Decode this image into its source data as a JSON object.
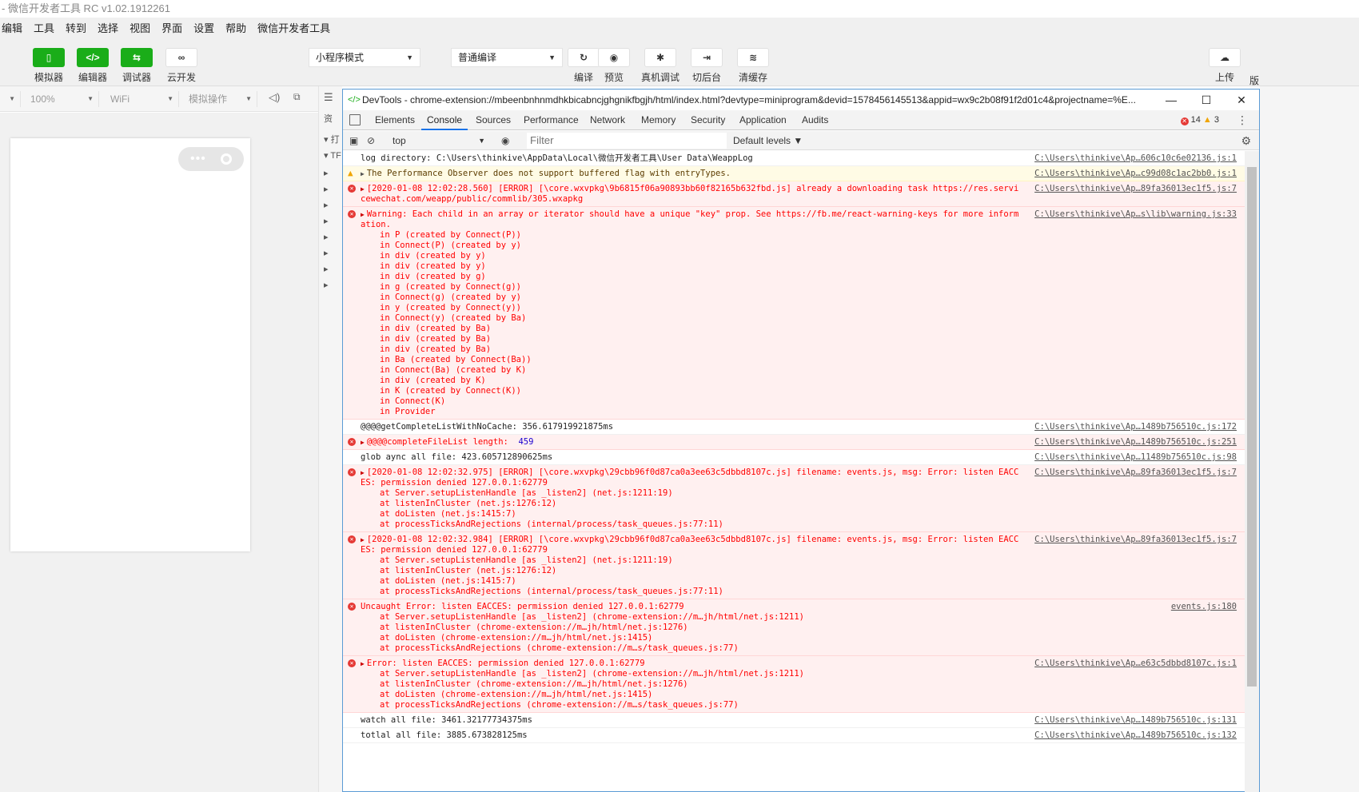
{
  "app": {
    "title": "- 微信开发者工具 RC v1.02.1912261"
  },
  "menu": [
    "编辑",
    "工具",
    "转到",
    "选择",
    "视图",
    "界面",
    "设置",
    "帮助",
    "微信开发者工具"
  ],
  "toolbar": {
    "simulator": "模拟器",
    "editor": "编辑器",
    "debugger": "调试器",
    "cloud": "云开发",
    "mode": "小程序模式",
    "compile_mode": "普通编译",
    "compile": "编译",
    "preview": "预览",
    "real_debug": "真机调试",
    "background": "切后台",
    "clear_cache": "清缓存",
    "upload": "上传",
    "edge": "版"
  },
  "sim": {
    "zoom": "100%",
    "network": "WiFi",
    "ops": "模拟操作"
  },
  "tree": {
    "first": "资",
    "item1": "▾ 打",
    "item2": "▾ TF"
  },
  "devtools": {
    "title": "DevTools - chrome-extension://mbeenbnhnmdhkbicabncjghgnikfbgjh/html/index.html?devtype=miniprogram&devid=1578456145513&appid=wx9c2b08f91f2d01c4&projectname=%E...",
    "tabs": [
      "Elements",
      "Console",
      "Sources",
      "Performance",
      "Network",
      "Memory",
      "Security",
      "Application",
      "Audits"
    ],
    "errors": "14",
    "warnings": "3",
    "context": "top",
    "filter_placeholder": "Filter",
    "levels": "Default levels ▼"
  },
  "console": [
    {
      "type": "log",
      "msg": "log directory: C:\\Users\\thinkive\\AppData\\Local\\微信开发者工具\\User Data\\WeappLog",
      "src": "C:\\Users\\thinkive\\Ap…606c10c6e02136.js:1"
    },
    {
      "type": "warn",
      "msg": "The Performance Observer does not support buffered flag with entryTypes.",
      "src": "C:\\Users\\thinkive\\Ap…c99d08c1ac2bb0.js:1"
    },
    {
      "type": "err",
      "msg": "[2020-01-08 12:02:28.560] [ERROR] [\\core.wxvpkg\\9b6815f06a90893bb60f82165b632fbd.js] already a downloading task https://res.servicewechat.com/weapp/public/commlib/305.wxapkg",
      "src": "C:\\Users\\thinkive\\Ap…89fa36013ec1f5.js:7"
    },
    {
      "type": "err",
      "msg": "Warning: Each child in an array or iterator should have a unique \"key\" prop. See https://fb.me/react-warning-keys for more information.",
      "src": "C:\\Users\\thinkive\\Ap…s\\lib\\warning.js:33",
      "stack": [
        "in P (created by Connect(P))",
        "in Connect(P) (created by y)",
        "in div (created by y)",
        "in div (created by y)",
        "in div (created by g)",
        "in g (created by Connect(g))",
        "in Connect(g) (created by y)",
        "in y (created by Connect(y))",
        "in Connect(y) (created by Ba)",
        "in div (created by Ba)",
        "in div (created by Ba)",
        "in div (created by Ba)",
        "in Ba (created by Connect(Ba))",
        "in Connect(Ba) (created by K)",
        "in div (created by K)",
        "in K (created by Connect(K))",
        "in Connect(K)",
        "in Provider"
      ]
    },
    {
      "type": "log",
      "msg": "@@@@getCompleteListWithNoCache: 356.617919921875ms",
      "src": "C:\\Users\\thinkive\\Ap…1489b756510c.js:172"
    },
    {
      "type": "err",
      "msg": "@@@@completeFileList length:  ",
      "num": "459",
      "src": "C:\\Users\\thinkive\\Ap…1489b756510c.js:251"
    },
    {
      "type": "log",
      "msg": "glob aync all file: 423.605712890625ms",
      "src": "C:\\Users\\thinkive\\Ap…11489b756510c.js:98"
    },
    {
      "type": "err",
      "msg": "[2020-01-08 12:02:32.975] [ERROR] [\\core.wxvpkg\\29cbb96f0d87ca0a3ee63c5dbbd8107c.js] filename: events.js, msg: Error: listen EACCES: permission denied 127.0.0.1:62779",
      "src": "C:\\Users\\thinkive\\Ap…89fa36013ec1f5.js:7",
      "stack": [
        "at Server.setupListenHandle [as _listen2] (net.js:1211:19)",
        "at listenInCluster (net.js:1276:12)",
        "at doListen (net.js:1415:7)",
        "at processTicksAndRejections (internal/process/task_queues.js:77:11)"
      ]
    },
    {
      "type": "err",
      "msg": "[2020-01-08 12:02:32.984] [ERROR] [\\core.wxvpkg\\29cbb96f0d87ca0a3ee63c5dbbd8107c.js] filename: events.js, msg: Error: listen EACCES: permission denied 127.0.0.1:62779",
      "src": "C:\\Users\\thinkive\\Ap…89fa36013ec1f5.js:7",
      "stack": [
        "at Server.setupListenHandle [as _listen2] (net.js:1211:19)",
        "at listenInCluster (net.js:1276:12)",
        "at doListen (net.js:1415:7)",
        "at processTicksAndRejections (internal/process/task_queues.js:77:11)"
      ]
    },
    {
      "type": "err",
      "noarrow": true,
      "msg": "Uncaught Error: listen EACCES: permission denied 127.0.0.1:62779",
      "src": "events.js:180",
      "stack": [
        "at Server.setupListenHandle [as _listen2] (chrome-extension://m…jh/html/net.js:1211)",
        "at listenInCluster (chrome-extension://m…jh/html/net.js:1276)",
        "at doListen (chrome-extension://m…jh/html/net.js:1415)",
        "at processTicksAndRejections (chrome-extension://m…s/task_queues.js:77)"
      ]
    },
    {
      "type": "err",
      "msg": "Error: listen EACCES: permission denied 127.0.0.1:62779",
      "src": "C:\\Users\\thinkive\\Ap…e63c5dbbd8107c.js:1",
      "stack": [
        "at Server.setupListenHandle [as _listen2] (chrome-extension://m…jh/html/net.js:1211)",
        "at listenInCluster (chrome-extension://m…jh/html/net.js:1276)",
        "at doListen (chrome-extension://m…jh/html/net.js:1415)",
        "at processTicksAndRejections (chrome-extension://m…s/task_queues.js:77)"
      ]
    },
    {
      "type": "log",
      "msg": "watch all file: 3461.32177734375ms",
      "src": "C:\\Users\\thinkive\\Ap…1489b756510c.js:131"
    },
    {
      "type": "log",
      "msg": "totlal all file: 3885.673828125ms",
      "src": "C:\\Users\\thinkive\\Ap…1489b756510c.js:132"
    }
  ],
  "colors": {
    "green": "#1aad19",
    "error": "#ff0000",
    "error_bg": "#fff0f0",
    "warn_bg": "#fffbe5"
  }
}
